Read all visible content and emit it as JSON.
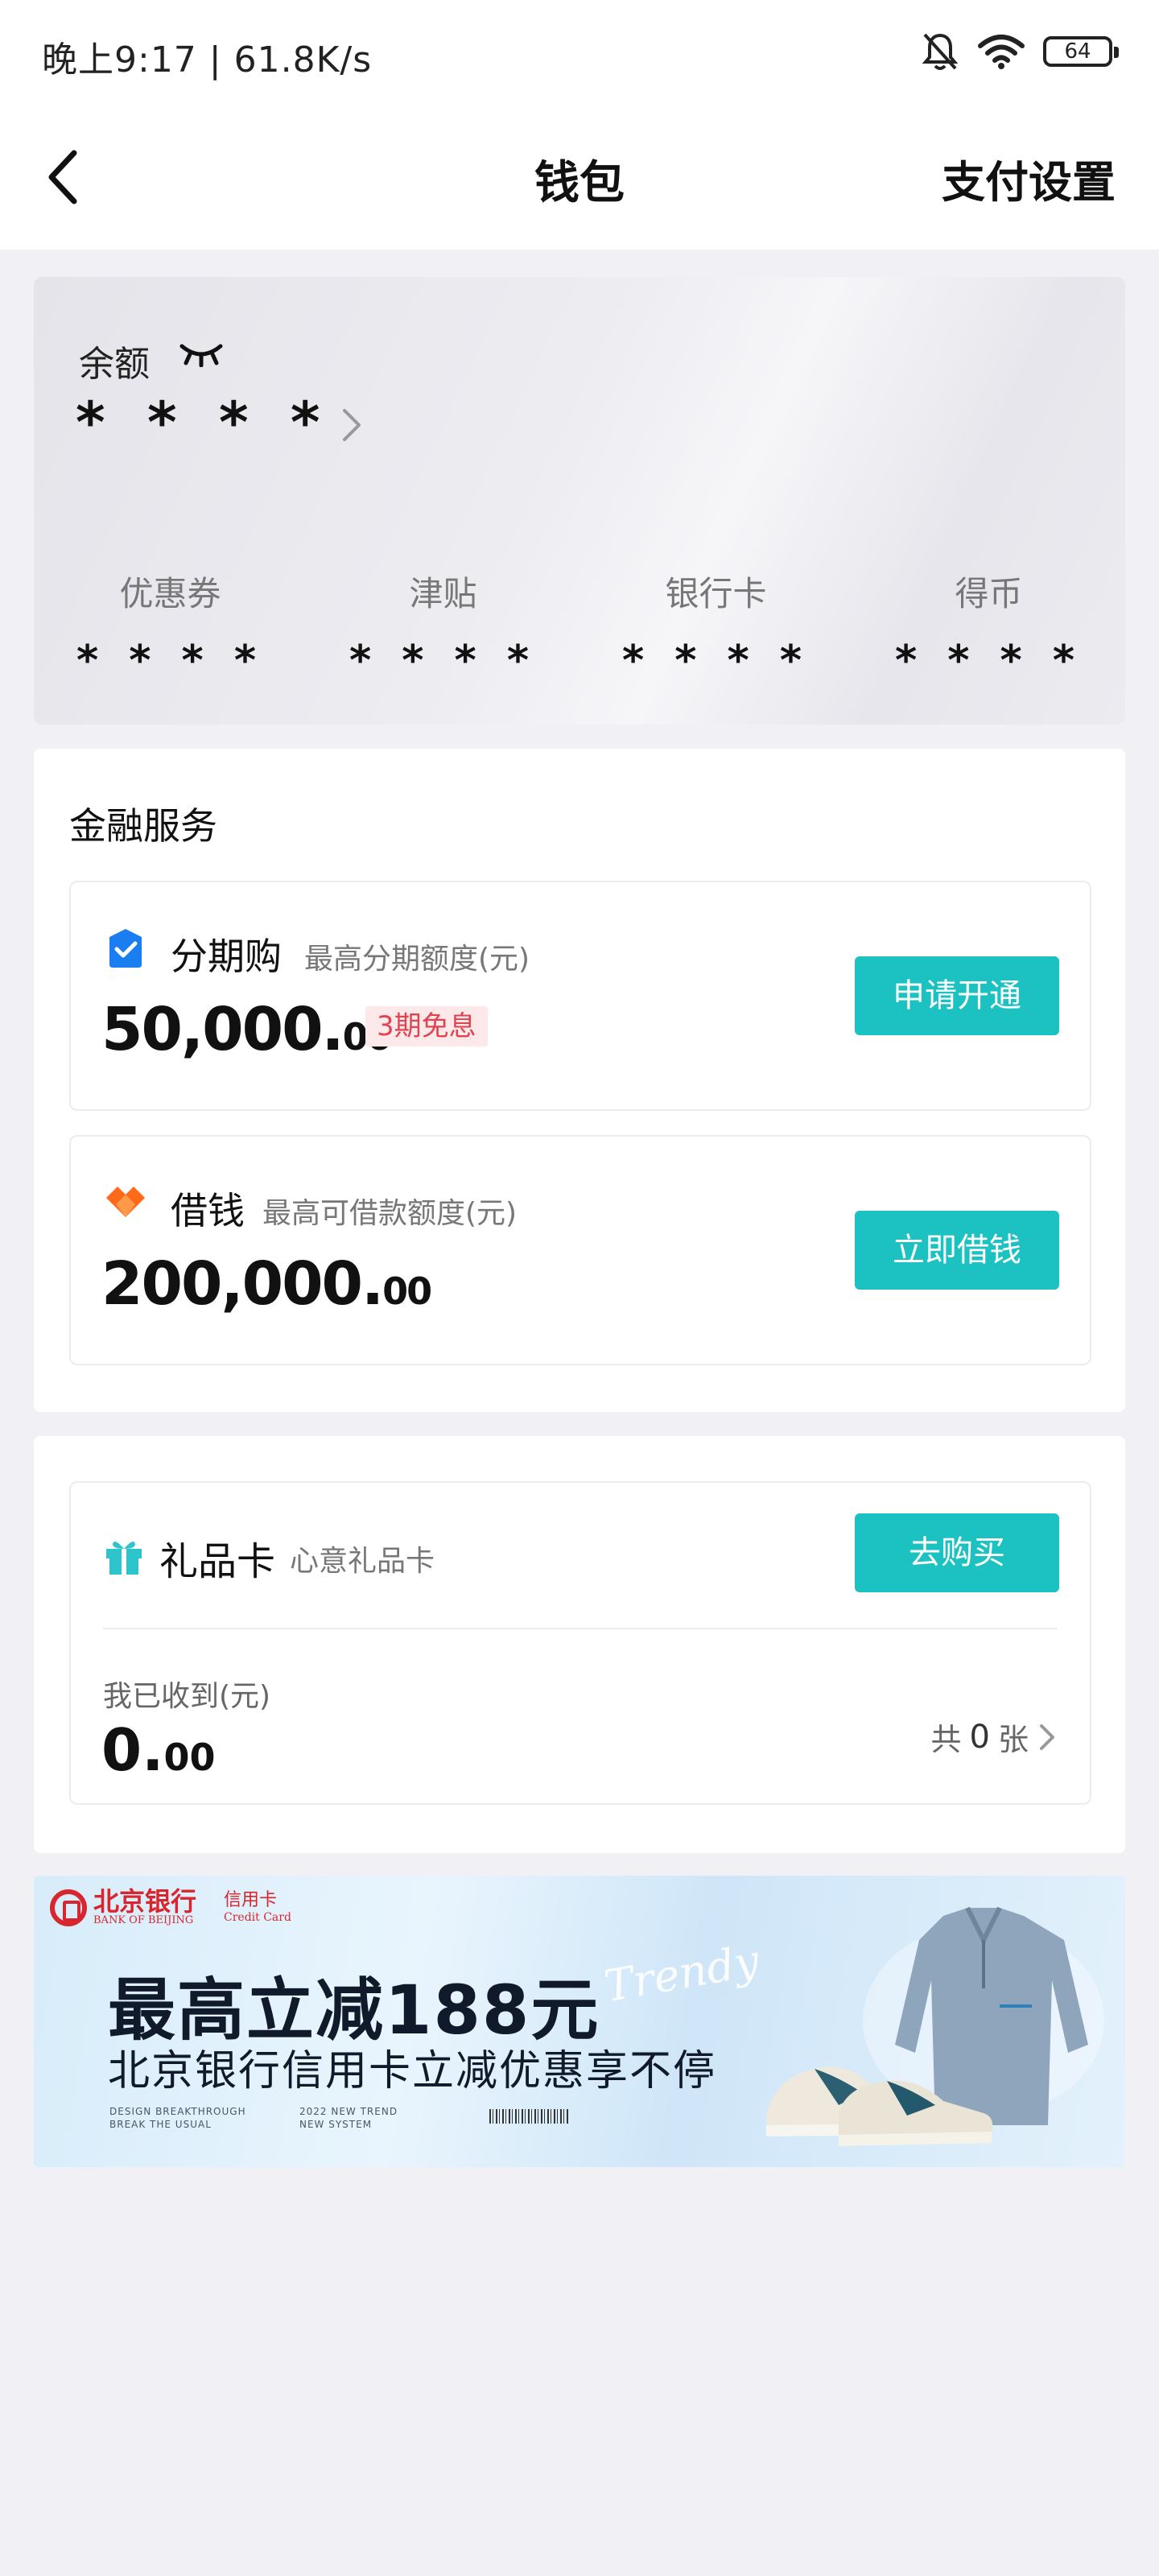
{
  "status_bar": {
    "time_speed": "晚上9:17 | 61.8K/s",
    "battery": "64"
  },
  "nav": {
    "title": "钱包",
    "right_action": "支付设置"
  },
  "balance": {
    "label": "余额",
    "value": "* * * *",
    "assets": [
      {
        "label": "优惠券",
        "value": "* * * *"
      },
      {
        "label": "津贴",
        "value": "* * * *"
      },
      {
        "label": "银行卡",
        "value": "* * * *"
      },
      {
        "label": "得币",
        "value": "* * * *"
      }
    ]
  },
  "finance": {
    "title": "金融服务",
    "installment": {
      "name": "分期购",
      "sub": "最高分期额度(元)",
      "amount_int": "50,000.",
      "amount_dec": "00",
      "tag": "3期免息",
      "button": "申请开通"
    },
    "loan": {
      "name": "借钱",
      "sub": "最高可借款额度(元)",
      "amount_int": "200,000.",
      "amount_dec": "00",
      "button": "立即借钱"
    }
  },
  "gift": {
    "name": "礼品卡",
    "sub": "心意礼品卡",
    "button": "去购买",
    "received_label": "我已收到(元)",
    "received_int": "0.",
    "received_dec": "00",
    "count_prefix": "共",
    "count": "0",
    "count_suffix": "张"
  },
  "banner": {
    "bank_name": "北京银行",
    "bank_en": "BANK OF BEIJING",
    "card_label": "信用卡",
    "card_en": "Credit Card",
    "headline": "最高立减188元",
    "script": "Trendy",
    "subline": "北京银行信用卡立减优惠享不停",
    "small_left": "DESIGN BREAKTHROUGH\nBREAK THE USUAL",
    "small_mid": "2022 NEW TREND\nNEW SYSTEM"
  },
  "colors": {
    "accent": "#1cc2c2",
    "tag_red": "#e0444f",
    "bank_red": "#d8262e"
  }
}
